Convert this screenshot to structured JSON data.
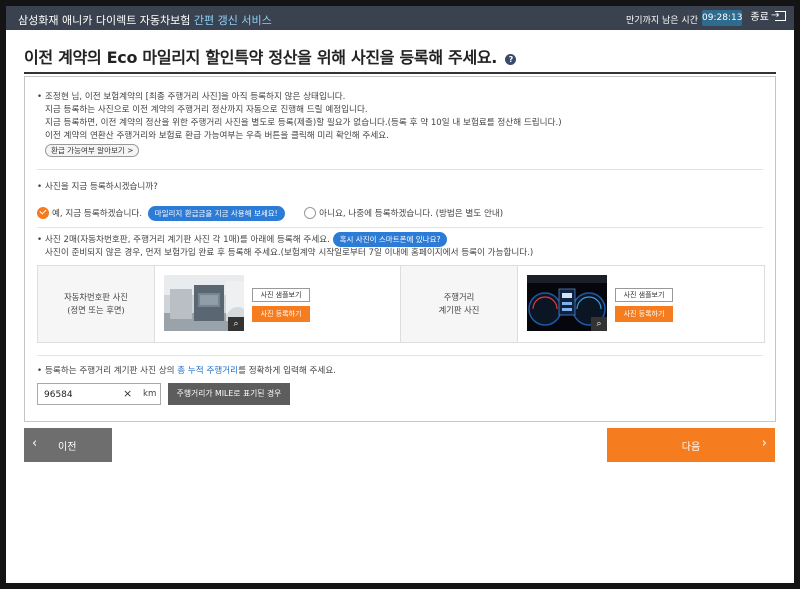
{
  "topbar": {
    "title": "삼성화재 애니카 다이렉트 자동차보험",
    "title_accent": "간편 갱신 서비스",
    "remain_label": "만기까지 남은 시간",
    "timer": "09:28:13",
    "exit_label": "종료"
  },
  "page": {
    "title": "이전 계약의 Eco 마일리지 할인특약 정산을 위해 사진을 등록해 주세요.",
    "help_icon": "?"
  },
  "notice": {
    "line1": "조정현 님, 이전 보험계약의 [최종 주행거리 사진]을 아직 등록하지 않은 상태입니다.",
    "line2": "지금 등록하는 사진으로 이전 계약의 주행거리 정산까지 자동으로 진행해 드릴 예정입니다.",
    "line3": "지금 등록하면, 이전 계약의 정산을 위한 주행거리 사진을 별도로 등록(제출)할 필요가 없습니다.(등록 후 약 10일 내 보험료를 정산해 드립니다.)",
    "line4": "이전 계약의 연환산 주행거리와 보험료 환급 가능여부는 우측 버튼을 클릭해 미리 확인해 주세요.",
    "refund_check_button": "환급 가능여부 알아보기 >"
  },
  "register_now": {
    "question": "사진을 지금 등록하시겠습니까?",
    "option_yes": "예, 지금 등록하겠습니다.",
    "option_yes_pill": "마일리지 환급금을 지금 사용해 보세요!",
    "option_no": "아니요, 나중에 등록하겠습니다. (방법은 별도 안내)"
  },
  "photos": {
    "instruction1": "사진 2매(자동차번호판, 주행거리 계기판 사진 각 1매)를 아래에 등록해 주세요.",
    "instruction_pill": "혹시 사진이 스마트폰에 있나요?",
    "instruction2": "사진이 준비되지 않은 경우, 먼저 보험가입 완료 후 등록해 주세요.(보험계약 시작일로부터 7일 이내에 홈페이지에서 등록이 가능합니다.)",
    "plate_label_1": "자동차번호판 사진",
    "plate_label_2": "(정면 또는 후면)",
    "gauge_label_1": "주행거리",
    "gauge_label_2": "계기판 사진",
    "sample_button": "사진 샘플보기",
    "register_button": "사진 등록하기",
    "zoom_icon": "search-icon"
  },
  "mileage": {
    "prompt_before": "등록하는 주행거리 계기판 사진 상의 ",
    "prompt_highlight": "총 누적 주행거리",
    "prompt_after": "를 정확하게 입력해 주세요.",
    "value": "96584",
    "clear_icon": "×",
    "unit": "km",
    "mile_button": "주행거리가 MILE로 표기된 경우"
  },
  "nav": {
    "prev_label": "이전",
    "next_label": "다음",
    "prev_icon": "‹",
    "next_icon": "›"
  },
  "colors": {
    "accent_orange": "#f57c1f",
    "accent_blue": "#2c7bd6",
    "topbar": "#3a4250",
    "highlight_text": "#1e6fd0"
  }
}
